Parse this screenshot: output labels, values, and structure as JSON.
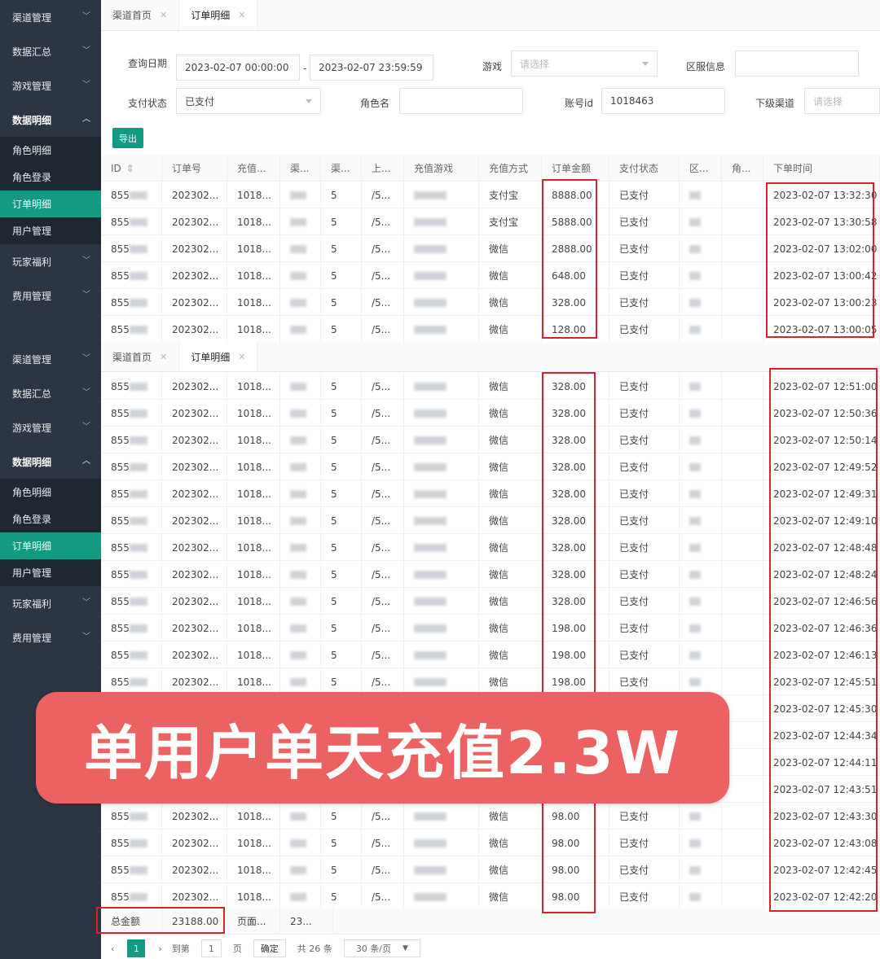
{
  "sidebar_top": [
    {
      "label": "渠道管理",
      "kind": "item"
    },
    {
      "label": "数据汇总",
      "kind": "item"
    },
    {
      "label": "游戏管理",
      "kind": "item"
    },
    {
      "label": "数据明细",
      "kind": "open"
    },
    {
      "label": "角色明细",
      "kind": "sub"
    },
    {
      "label": "角色登录",
      "kind": "sub"
    },
    {
      "label": "订单明细",
      "kind": "active"
    },
    {
      "label": "用户管理",
      "kind": "sub"
    },
    {
      "label": "玩家福利",
      "kind": "item"
    },
    {
      "label": "费用管理",
      "kind": "item"
    }
  ],
  "tabs": [
    {
      "label": "渠道首页",
      "close": "✕"
    },
    {
      "label": "订单明细",
      "close": "✕"
    }
  ],
  "filters": {
    "date_label": "查询日期",
    "date_start": "2023-02-07 00:00:00",
    "date_sep": "-",
    "date_end": "2023-02-07 23:59:59",
    "game_label": "游戏",
    "game_placeholder": "请选择",
    "server_label": "区服信息",
    "pay_status_label": "支付状态",
    "pay_status_value": "已支付",
    "role_label": "角色名",
    "account_label": "账号id",
    "account_value": "1018463",
    "channel_label": "下级渠道",
    "channel_placeholder": "请选择"
  },
  "export_label": "导出",
  "headers": [
    "ID",
    "订单号",
    "充值...",
    "渠...",
    "渠...",
    "上...",
    "充值游戏",
    "充值方式",
    "订单金额",
    "支付状态",
    "区...",
    "角...",
    "下单时间"
  ],
  "sort_icon": "⇕",
  "rows_top": [
    {
      "id": "855",
      "order": "202302...",
      "uid": "1018...",
      "ch": "5",
      "up": "/5...",
      "pay": "支付宝",
      "amount": "8888.00",
      "status": "已支付",
      "time": "2023-02-07 13:32:30"
    },
    {
      "id": "855",
      "order": "202302...",
      "uid": "1018...",
      "ch": "5",
      "up": "/5...",
      "pay": "支付宝",
      "amount": "5888.00",
      "status": "已支付",
      "time": "2023-02-07 13:30:58"
    },
    {
      "id": "855",
      "order": "202302...",
      "uid": "1018...",
      "ch": "5",
      "up": "/5...",
      "pay": "微信",
      "amount": "2888.00",
      "status": "已支付",
      "time": "2023-02-07 13:02:00"
    },
    {
      "id": "855",
      "order": "202302...",
      "uid": "1018...",
      "ch": "5",
      "up": "/5...",
      "pay": "微信",
      "amount": "648.00",
      "status": "已支付",
      "time": "2023-02-07 13:00:42"
    },
    {
      "id": "855",
      "order": "202302...",
      "uid": "1018...",
      "ch": "5",
      "up": "/5...",
      "pay": "微信",
      "amount": "328.00",
      "status": "已支付",
      "time": "2023-02-07 13:00:23"
    },
    {
      "id": "855",
      "order": "202302...",
      "uid": "1018...",
      "ch": "5",
      "up": "/5...",
      "pay": "微信",
      "amount": "128.00",
      "status": "已支付",
      "time": "2023-02-07 13:00:05"
    }
  ],
  "rows_bottom": [
    {
      "id": "855",
      "order": "202302...",
      "uid": "1018...",
      "ch": "5",
      "up": "/5...",
      "pay": "微信",
      "amount": "328.00",
      "status": "已支付",
      "time": "2023-02-07 12:51:00"
    },
    {
      "id": "855",
      "order": "202302...",
      "uid": "1018...",
      "ch": "5",
      "up": "/5...",
      "pay": "微信",
      "amount": "328.00",
      "status": "已支付",
      "time": "2023-02-07 12:50:36"
    },
    {
      "id": "855",
      "order": "202302...",
      "uid": "1018...",
      "ch": "5",
      "up": "/5...",
      "pay": "微信",
      "amount": "328.00",
      "status": "已支付",
      "time": "2023-02-07 12:50:14"
    },
    {
      "id": "855",
      "order": "202302...",
      "uid": "1018...",
      "ch": "5",
      "up": "/5...",
      "pay": "微信",
      "amount": "328.00",
      "status": "已支付",
      "time": "2023-02-07 12:49:52"
    },
    {
      "id": "855",
      "order": "202302...",
      "uid": "1018...",
      "ch": "5",
      "up": "/5...",
      "pay": "微信",
      "amount": "328.00",
      "status": "已支付",
      "time": "2023-02-07 12:49:31"
    },
    {
      "id": "855",
      "order": "202302...",
      "uid": "1018...",
      "ch": "5",
      "up": "/5...",
      "pay": "微信",
      "amount": "328.00",
      "status": "已支付",
      "time": "2023-02-07 12:49:10"
    },
    {
      "id": "855",
      "order": "202302...",
      "uid": "1018...",
      "ch": "5",
      "up": "/5...",
      "pay": "微信",
      "amount": "328.00",
      "status": "已支付",
      "time": "2023-02-07 12:48:48"
    },
    {
      "id": "855",
      "order": "202302...",
      "uid": "1018...",
      "ch": "5",
      "up": "/5...",
      "pay": "微信",
      "amount": "328.00",
      "status": "已支付",
      "time": "2023-02-07 12:48:24"
    },
    {
      "id": "855",
      "order": "202302...",
      "uid": "1018...",
      "ch": "5",
      "up": "/5...",
      "pay": "微信",
      "amount": "328.00",
      "status": "已支付",
      "time": "2023-02-07 12:46:56"
    },
    {
      "id": "855",
      "order": "202302...",
      "uid": "1018...",
      "ch": "5",
      "up": "/5...",
      "pay": "微信",
      "amount": "198.00",
      "status": "已支付",
      "time": "2023-02-07 12:46:36"
    },
    {
      "id": "855",
      "order": "202302...",
      "uid": "1018...",
      "ch": "5",
      "up": "/5...",
      "pay": "微信",
      "amount": "198.00",
      "status": "已支付",
      "time": "2023-02-07 12:46:13"
    },
    {
      "id": "855",
      "order": "202302...",
      "uid": "1018...",
      "ch": "5",
      "up": "/5...",
      "pay": "微信",
      "amount": "198.00",
      "status": "已支付",
      "time": "2023-02-07 12:45:51"
    },
    {
      "id": "",
      "order": "",
      "uid": "",
      "ch": "",
      "up": "",
      "pay": "",
      "amount": "",
      "status": "",
      "time": "2023-02-07 12:45:30"
    },
    {
      "id": "",
      "order": "",
      "uid": "",
      "ch": "",
      "up": "",
      "pay": "",
      "amount": "",
      "status": "",
      "time": "2023-02-07 12:44:34"
    },
    {
      "id": "",
      "order": "",
      "uid": "",
      "ch": "",
      "up": "",
      "pay": "",
      "amount": "",
      "status": "",
      "time": "2023-02-07 12:44:11"
    },
    {
      "id": "",
      "order": "",
      "uid": "",
      "ch": "",
      "up": "",
      "pay": "",
      "amount": "",
      "status": "",
      "time": "2023-02-07 12:43:51"
    },
    {
      "id": "855",
      "order": "202302...",
      "uid": "1018...",
      "ch": "5",
      "up": "/5...",
      "pay": "微信",
      "amount": "98.00",
      "status": "已支付",
      "time": "2023-02-07 12:43:30"
    },
    {
      "id": "855",
      "order": "202302...",
      "uid": "1018...",
      "ch": "5",
      "up": "/5...",
      "pay": "微信",
      "amount": "98.00",
      "status": "已支付",
      "time": "2023-02-07 12:43:08"
    },
    {
      "id": "855",
      "order": "202302...",
      "uid": "1018...",
      "ch": "5",
      "up": "/5...",
      "pay": "微信",
      "amount": "98.00",
      "status": "已支付",
      "time": "2023-02-07 12:42:45"
    },
    {
      "id": "855",
      "order": "202302...",
      "uid": "1018...",
      "ch": "5",
      "up": "/5...",
      "pay": "微信",
      "amount": "98.00",
      "status": "已支付",
      "time": "2023-02-07 12:42:20"
    }
  ],
  "banner_text": "单用户单天充值2.3W",
  "footer": {
    "total_label": "总金额",
    "total_value": "23188.00",
    "page_label": "页面...",
    "page_value": "23..."
  },
  "pager": {
    "prev": "‹",
    "current": "1",
    "next": "›",
    "goto_label": "到第",
    "goto_value": "1",
    "page_unit": "页",
    "confirm": "确定",
    "total": "共 26 条",
    "per_page": "30 条/页"
  },
  "colors": {
    "accent": "#139a82",
    "sidebar": "#2c3544",
    "highlight": "#d8232a",
    "banner": "#ec6262"
  }
}
